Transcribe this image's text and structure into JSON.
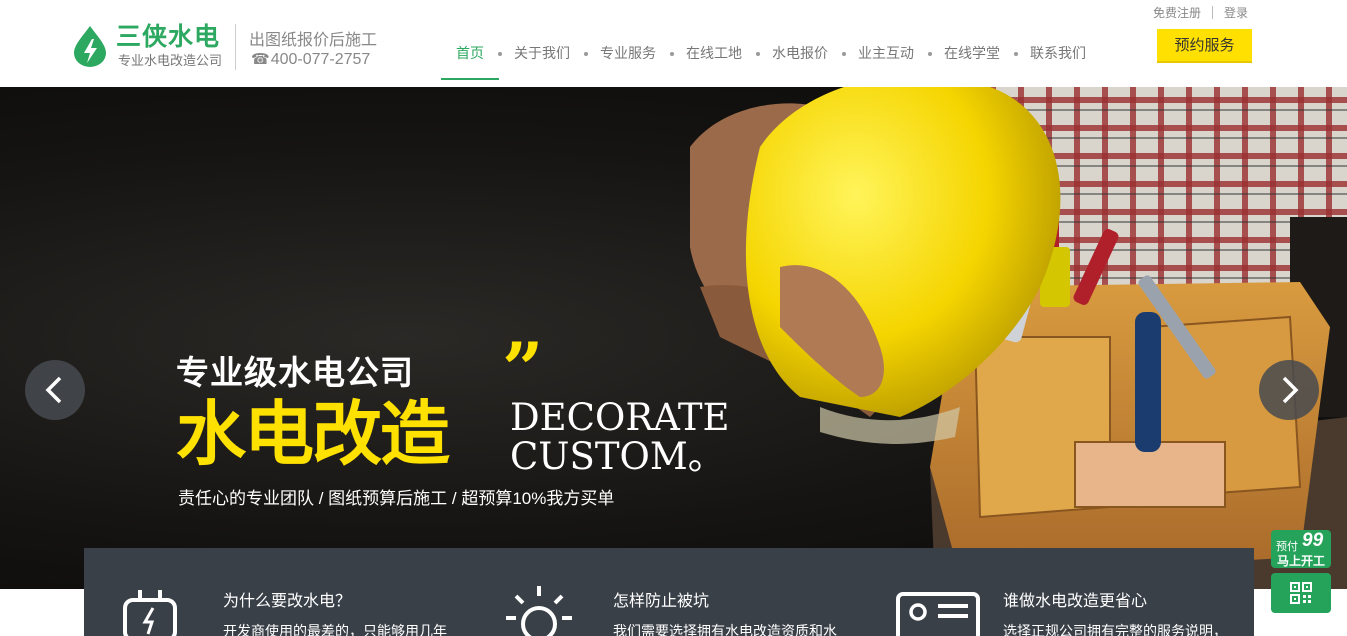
{
  "header": {
    "logo_name": "三侠水电",
    "logo_sub": "专业水电改造公司",
    "slogan": "出图纸报价后施工",
    "phone_icon": "☎",
    "phone": "400-077-2757",
    "top_links": {
      "register": "免费注册",
      "login": "登录"
    },
    "book_button": "预约服务",
    "nav": [
      {
        "label": "首页",
        "active": true
      },
      {
        "label": "关于我们"
      },
      {
        "label": "专业服务"
      },
      {
        "label": "在线工地"
      },
      {
        "label": "水电报价"
      },
      {
        "label": "业主互动"
      },
      {
        "label": "在线学堂"
      },
      {
        "label": "联系我们"
      }
    ]
  },
  "banner": {
    "headline_small": "专业级水电公司",
    "quote": "”",
    "headline_big": "水电改造",
    "english_line1": "DECORATE",
    "english_line2": "CUSTOM。",
    "tagline": "责任心的专业团队 / 图纸预算后施工 / 超预算10%我方买单",
    "prev_icon": "chevron-left-icon",
    "next_icon": "chevron-right-icon"
  },
  "features": [
    {
      "icon": "plug-icon",
      "title": "为什么要改水电？",
      "desc": "开发商使用的最差的，只能够用几年"
    },
    {
      "icon": "sun-icon",
      "title": "怎样防止被坑",
      "desc": "我们需要选择拥有水电改造资质和水"
    },
    {
      "icon": "id-card-icon",
      "title": "谁做水电改造更省心",
      "desc": "选择正规公司拥有完整的服务说明，"
    }
  ],
  "side_float": {
    "prepay": "预付",
    "prepay_num": "99",
    "start": "马上开工",
    "qr_icon": "qr-code-icon"
  },
  "colors": {
    "brand_green": "#2ca860",
    "accent_yellow": "#ffe100",
    "feature_bg": "#3a4048"
  }
}
